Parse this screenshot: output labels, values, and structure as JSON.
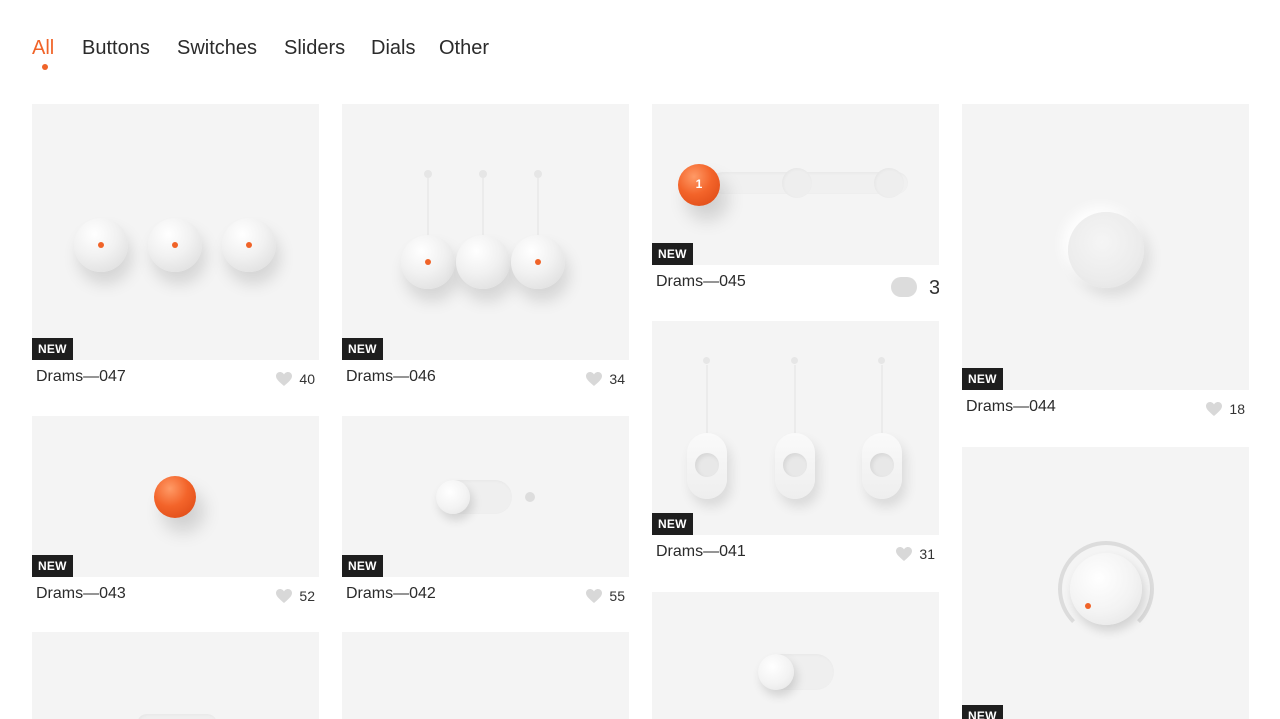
{
  "nav": {
    "tabs": [
      {
        "label": "All",
        "active": true
      },
      {
        "label": "Buttons",
        "active": false
      },
      {
        "label": "Switches",
        "active": false
      },
      {
        "label": "Sliders",
        "active": false
      },
      {
        "label": "Dials",
        "active": false
      },
      {
        "label": "Other",
        "active": false
      }
    ]
  },
  "accent_color": "#f06328",
  "badge_label": "NEW",
  "cards": [
    {
      "title": "Drams—047",
      "likes": "40",
      "badge": "NEW"
    },
    {
      "title": "Drams—046",
      "likes": "34",
      "badge": "NEW"
    },
    {
      "title": "Drams—045",
      "likes": "3",
      "badge": "NEW",
      "slider_value": "1"
    },
    {
      "title": "Drams—044",
      "likes": "18",
      "badge": "NEW"
    },
    {
      "title": "Drams—043",
      "likes": "52",
      "badge": "NEW"
    },
    {
      "title": "Drams—042",
      "likes": "55",
      "badge": "NEW"
    },
    {
      "title": "Drams—041",
      "likes": "31",
      "badge": "NEW"
    },
    {
      "title": "",
      "likes": "",
      "badge": "NEW"
    }
  ],
  "icons": {
    "like": "heart-icon"
  }
}
